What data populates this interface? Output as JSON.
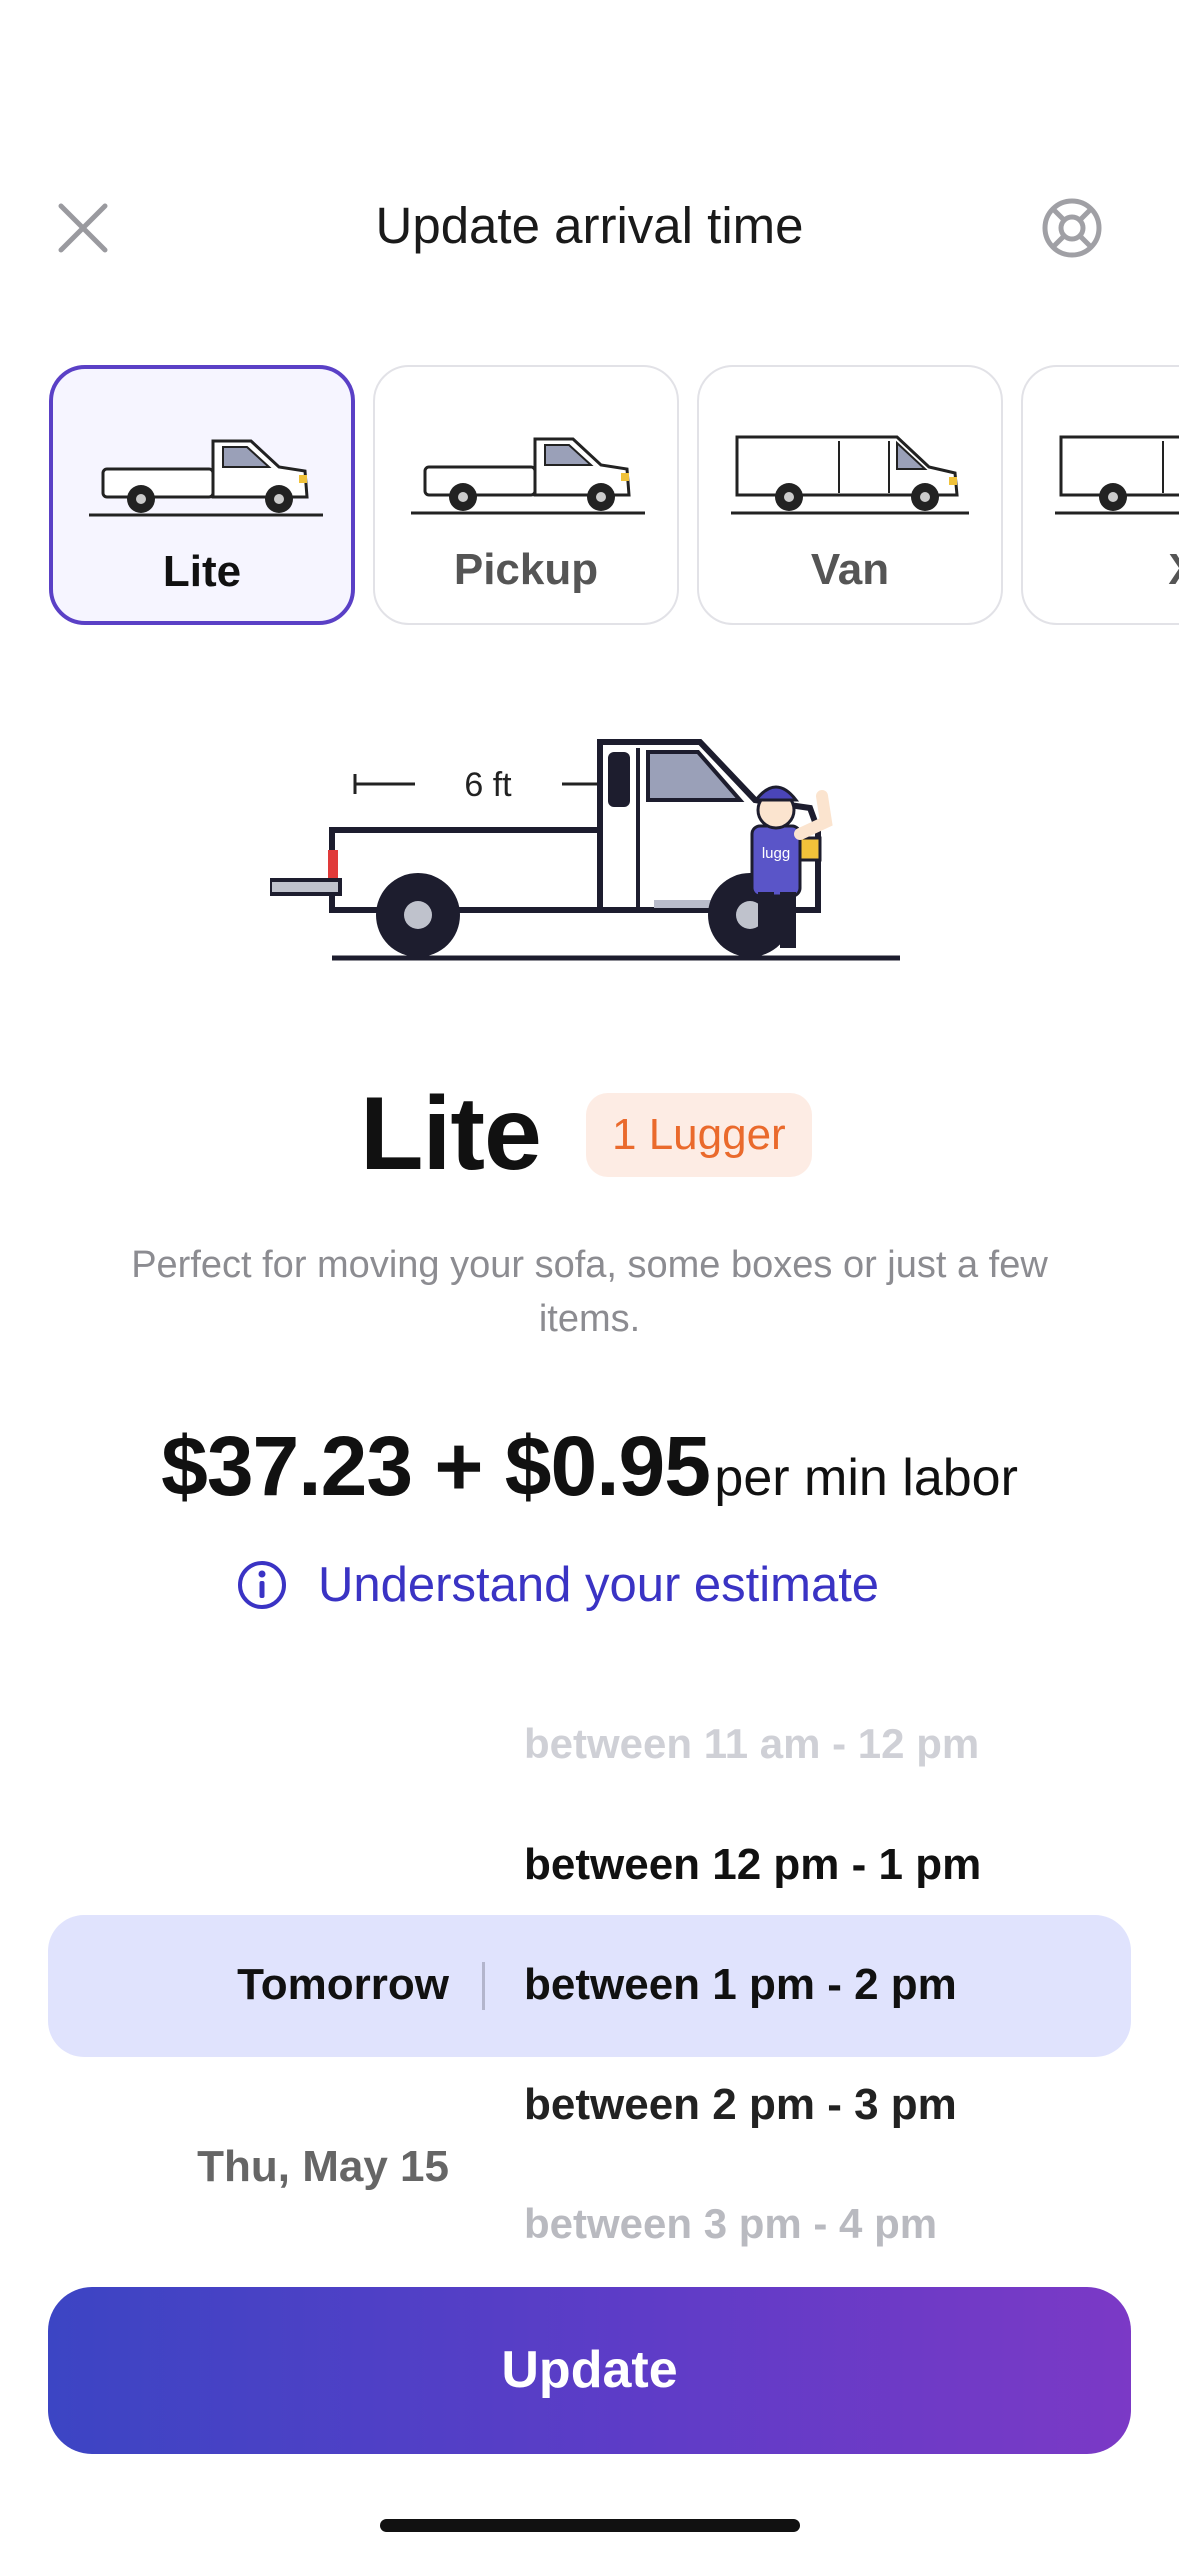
{
  "header": {
    "title": "Update arrival time",
    "close_icon": "close-icon",
    "help_icon": "lifebuoy-icon"
  },
  "vehicles": [
    {
      "label": "Lite",
      "selected": true,
      "icon": "pickup-truck-icon"
    },
    {
      "label": "Pickup",
      "selected": false,
      "icon": "pickup-truck-icon"
    },
    {
      "label": "Van",
      "selected": false,
      "icon": "van-icon"
    },
    {
      "label": "X",
      "selected": false,
      "icon": "van-icon"
    }
  ],
  "hero": {
    "bed_length_label": "6 ft",
    "shirt_text": "lugg"
  },
  "service": {
    "name": "Lite",
    "badge": "1 Lugger",
    "description": "Perfect for moving your sofa, some boxes or just a few items."
  },
  "price": {
    "main": "$37.23 + $0.95",
    "unit": "per min labor"
  },
  "estimate_link": {
    "label": "Understand your estimate",
    "icon": "info-icon"
  },
  "picker": {
    "days": [
      "Tomorrow",
      "Thu, May 15"
    ],
    "selected_day": "Tomorrow",
    "times": [
      "between 11 am - 12 pm",
      "between 12 pm - 1 pm",
      "between 1 pm - 2 pm",
      "between 2 pm - 3 pm",
      "between 3 pm - 4 pm"
    ],
    "selected_time": "between 1 pm - 2 pm"
  },
  "update_button": {
    "label": "Update"
  },
  "colors": {
    "accent": "#5a40c6",
    "link": "#3a33c4",
    "badge_bg": "#fdece4",
    "badge_text": "#ea6a2c",
    "picker_band": "#e0e3fd"
  }
}
